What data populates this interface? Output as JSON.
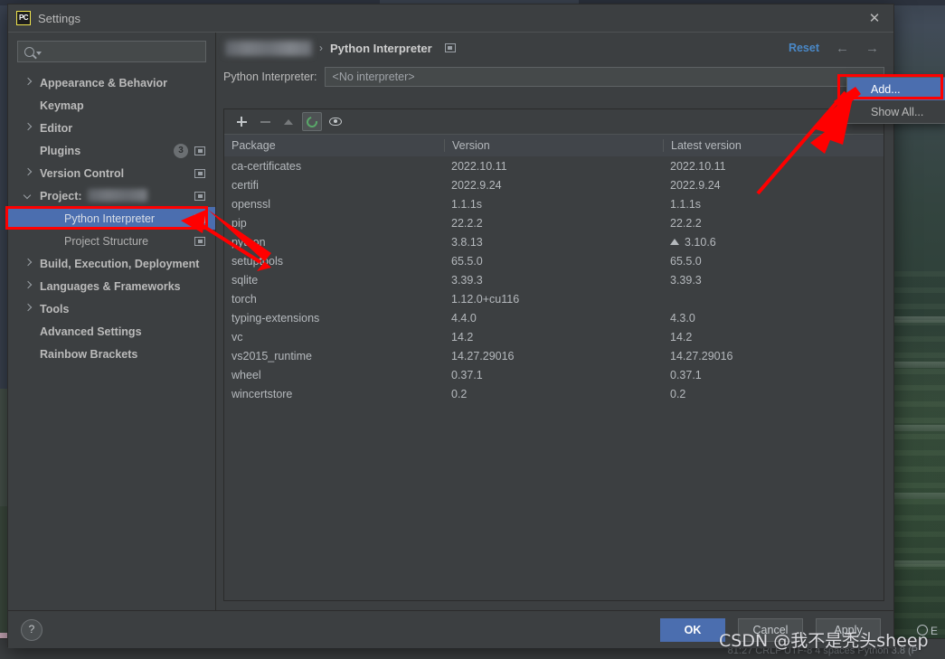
{
  "window": {
    "title": "Settings",
    "logo_text": "PC",
    "close_icon": "close-icon"
  },
  "sidebar": {
    "search": {
      "value": "",
      "placeholder": ""
    },
    "items": [
      {
        "label": "Appearance & Behavior",
        "arrow": "right",
        "indent": 0,
        "badge": null,
        "win_icon": false,
        "selected": false
      },
      {
        "label": "Keymap",
        "arrow": "none",
        "indent": 0,
        "badge": null,
        "win_icon": false,
        "selected": false
      },
      {
        "label": "Editor",
        "arrow": "right",
        "indent": 0,
        "badge": null,
        "win_icon": false,
        "selected": false
      },
      {
        "label": "Plugins",
        "arrow": "none",
        "indent": 0,
        "badge": "3",
        "win_icon": true,
        "selected": false
      },
      {
        "label": "Version Control",
        "arrow": "right",
        "indent": 0,
        "badge": null,
        "win_icon": true,
        "selected": false
      },
      {
        "label": "Project:",
        "arrow": "down",
        "indent": 0,
        "badge": null,
        "win_icon": true,
        "selected": false,
        "blurred": true
      },
      {
        "label": "Python Interpreter",
        "arrow": "none",
        "indent": 1,
        "badge": null,
        "win_icon": true,
        "selected": true
      },
      {
        "label": "Project Structure",
        "arrow": "none",
        "indent": 1,
        "badge": null,
        "win_icon": true,
        "selected": false
      },
      {
        "label": "Build, Execution, Deployment",
        "arrow": "right",
        "indent": 0,
        "badge": null,
        "win_icon": false,
        "selected": false
      },
      {
        "label": "Languages & Frameworks",
        "arrow": "right",
        "indent": 0,
        "badge": null,
        "win_icon": false,
        "selected": false
      },
      {
        "label": "Tools",
        "arrow": "right",
        "indent": 0,
        "badge": null,
        "win_icon": false,
        "selected": false
      },
      {
        "label": "Advanced Settings",
        "arrow": "none",
        "indent": 0,
        "badge": null,
        "win_icon": false,
        "selected": false
      },
      {
        "label": "Rainbow Brackets",
        "arrow": "none",
        "indent": 0,
        "badge": null,
        "win_icon": false,
        "selected": false
      }
    ]
  },
  "main": {
    "breadcrumb": {
      "project_blurred": true,
      "separator": "›",
      "title": "Python Interpreter"
    },
    "reset_label": "Reset",
    "back_icon": "arrow-left-icon",
    "forward_icon": "arrow-right-icon",
    "interpreter": {
      "label": "Python Interpreter:",
      "value": "<No interpreter>"
    },
    "dropdown": {
      "items": [
        {
          "label": "Add...",
          "highlighted": true
        },
        {
          "label": "Show All...",
          "highlighted": false
        }
      ]
    },
    "toolbar": [
      {
        "icon": "plus-icon",
        "enabled": true,
        "selected": false
      },
      {
        "icon": "minus-icon",
        "enabled": false,
        "selected": false
      },
      {
        "icon": "upgrade-arrow-icon",
        "enabled": false,
        "selected": false
      },
      {
        "icon": "refresh-icon",
        "enabled": true,
        "selected": true
      },
      {
        "icon": "eye-icon",
        "enabled": true,
        "selected": false
      }
    ],
    "packages_table": {
      "columns": [
        "Package",
        "Version",
        "Latest version"
      ],
      "rows": [
        {
          "package": "ca-certificates",
          "version": "2022.10.11",
          "latest": "2022.10.11",
          "upgradable": false
        },
        {
          "package": "certifi",
          "version": "2022.9.24",
          "latest": "2022.9.24",
          "upgradable": false
        },
        {
          "package": "openssl",
          "version": "1.1.1s",
          "latest": "1.1.1s",
          "upgradable": false
        },
        {
          "package": "pip",
          "version": "22.2.2",
          "latest": "22.2.2",
          "upgradable": false
        },
        {
          "package": "python",
          "version": "3.8.13",
          "latest": "3.10.6",
          "upgradable": true
        },
        {
          "package": "setuptools",
          "version": "65.5.0",
          "latest": "65.5.0",
          "upgradable": false
        },
        {
          "package": "sqlite",
          "version": "3.39.3",
          "latest": "3.39.3",
          "upgradable": false
        },
        {
          "package": "torch",
          "version": "1.12.0+cu116",
          "latest": "",
          "upgradable": false
        },
        {
          "package": "typing-extensions",
          "version": "4.4.0",
          "latest": "4.3.0",
          "upgradable": false
        },
        {
          "package": "vc",
          "version": "14.2",
          "latest": "14.2",
          "upgradable": false
        },
        {
          "package": "vs2015_runtime",
          "version": "14.27.29016",
          "latest": "14.27.29016",
          "upgradable": false
        },
        {
          "package": "wheel",
          "version": "0.37.1",
          "latest": "0.37.1",
          "upgradable": false
        },
        {
          "package": "wincertstore",
          "version": "0.2",
          "latest": "0.2",
          "upgradable": false
        }
      ]
    }
  },
  "footer": {
    "help_label": "?",
    "ok_label": "OK",
    "cancel_label": "Cancel",
    "apply_label": "Apply"
  },
  "overlay": {
    "watermark": "CSDN @我不是秃头sheep",
    "annotation_color": "#ff0000",
    "ide_status": "81:27   CRLF   UTF-8   4 spaces   Python 3.8 (P",
    "ide_search_icon": "search-icon"
  },
  "theme": {
    "dialog_bg": "#3c3f41",
    "accent": "#4b6eaf",
    "text": "#bbbbbb",
    "link": "#4a88c7",
    "green": "#59a869"
  }
}
